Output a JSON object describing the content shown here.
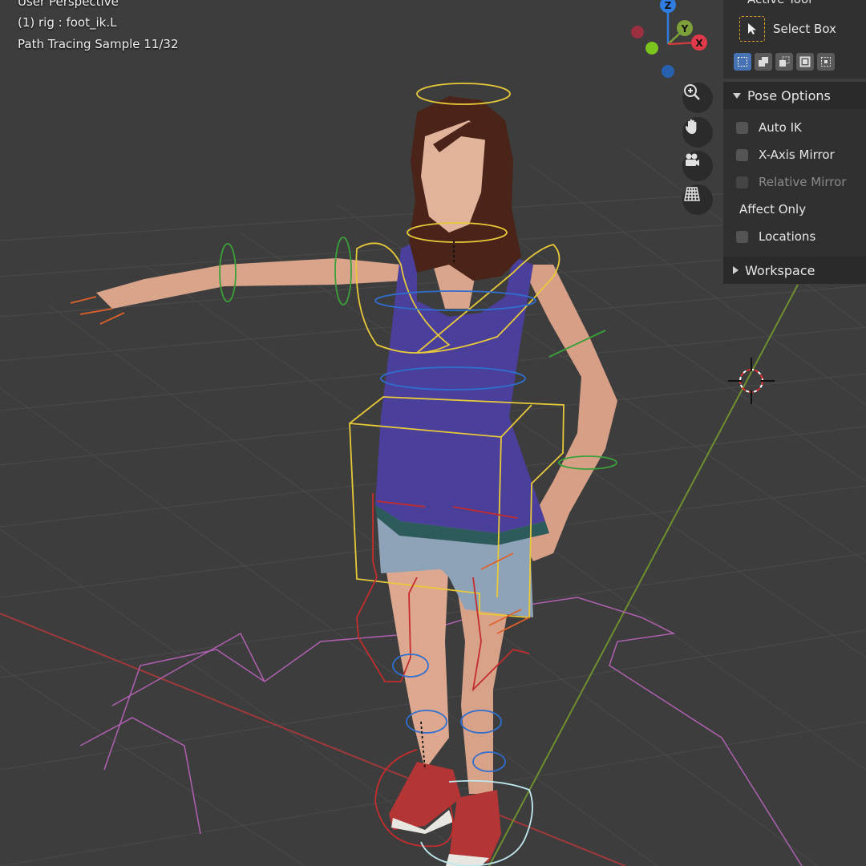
{
  "viewport": {
    "view_name": "User Perspective",
    "active_object": "(1) rig : foot_ik.L",
    "render_status": "Path Tracing Sample 11/32"
  },
  "gizmo": {
    "axes": [
      "Z",
      "Y",
      "X"
    ]
  },
  "nav_buttons": [
    "zoom-icon",
    "hand-pan-icon",
    "camera-icon",
    "grid-ortho-icon"
  ],
  "npanel": {
    "active_tool": {
      "header": "Active Tool",
      "tool_name": "Select Box",
      "modes": [
        "set",
        "extend",
        "subtract",
        "invert",
        "intersect"
      ]
    },
    "pose_options": {
      "header": "Pose Options",
      "items": [
        {
          "label": "Auto IK",
          "checked": false
        },
        {
          "label": "X-Axis Mirror",
          "checked": false
        },
        {
          "label": "Relative Mirror",
          "checked": false,
          "disabled": true
        }
      ],
      "affect_only_label": "Affect Only",
      "locations_label": "Locations"
    },
    "workspace": {
      "header": "Workspace"
    }
  },
  "colors": {
    "background": "#3d3d3d",
    "x_axis": "#c83c3c",
    "y_axis": "#7ea03a",
    "z_axis": "#2f7de0",
    "selected_bone": "#e8c93a",
    "accent": "#4772b3"
  }
}
